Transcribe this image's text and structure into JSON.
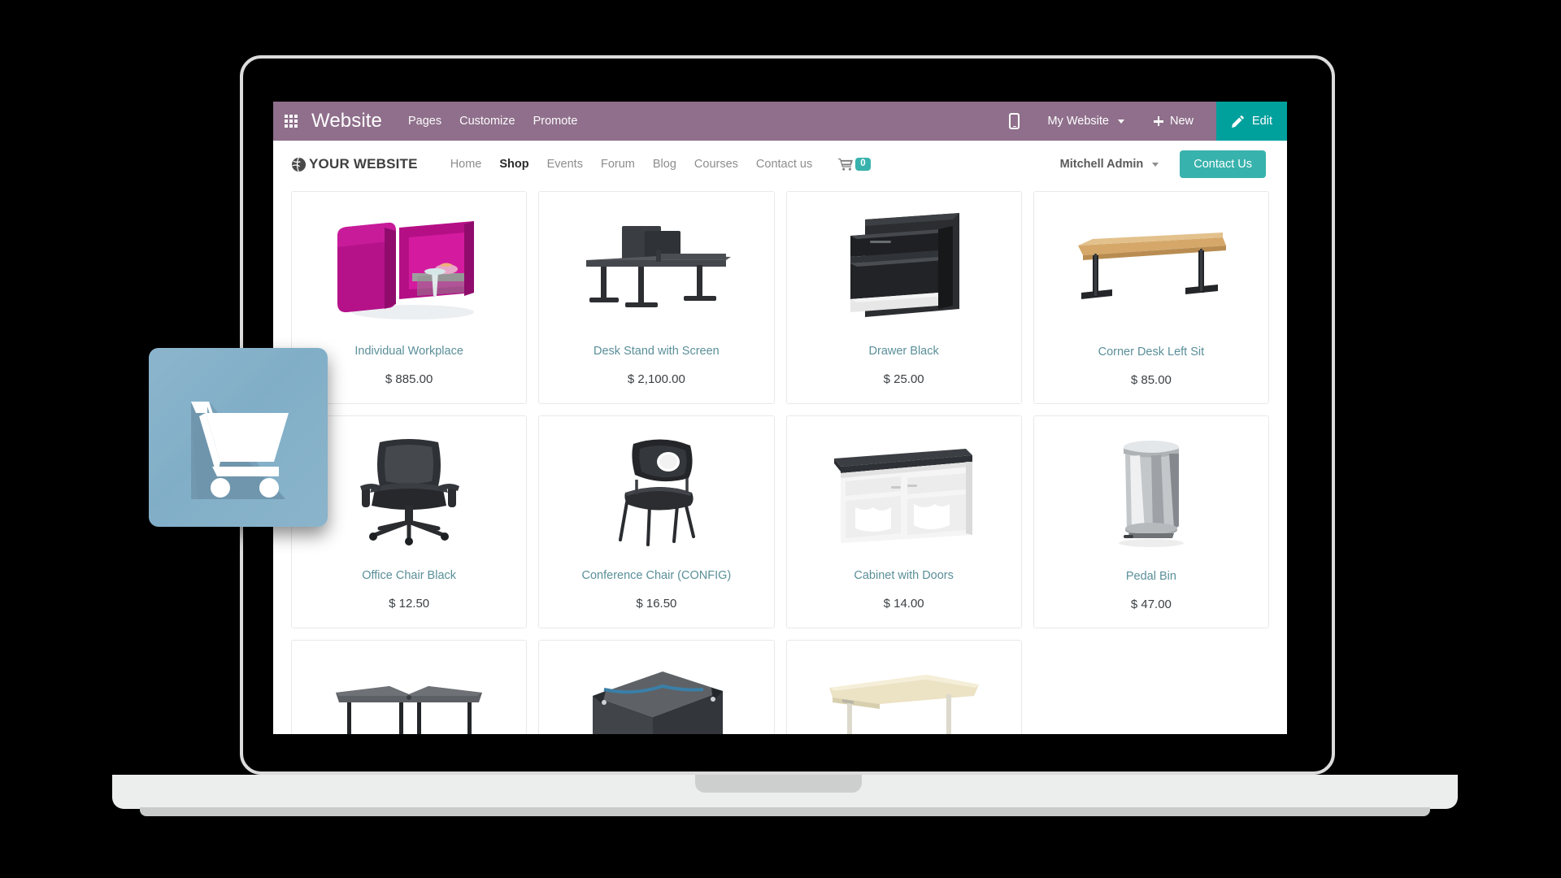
{
  "odoo_topbar": {
    "apps_icon": "apps-grid-icon",
    "app_name": "Website",
    "menus": [
      {
        "label": "Pages"
      },
      {
        "label": "Customize"
      },
      {
        "label": "Promote"
      }
    ],
    "mobile_preview_icon": "mobile-phone-icon",
    "website_selector": "My Website",
    "new_label": "New",
    "new_icon": "plus-icon",
    "edit_label": "Edit",
    "edit_icon": "pencil-icon",
    "bar_color": "#8f6f8b",
    "accent_color": "#00a09d"
  },
  "site_header": {
    "logo_icon": "globe-icon",
    "logo_text": "YOUR WEBSITE",
    "nav": [
      {
        "label": "Home",
        "active": false
      },
      {
        "label": "Shop",
        "active": true
      },
      {
        "label": "Events",
        "active": false
      },
      {
        "label": "Forum",
        "active": false
      },
      {
        "label": "Blog",
        "active": false
      },
      {
        "label": "Courses",
        "active": false
      },
      {
        "label": "Contact us",
        "active": false
      }
    ],
    "cart_icon": "shopping-cart-icon",
    "cart_count": "0",
    "user_menu": "Mitchell Admin",
    "cta_label": "Contact Us",
    "cta_color": "#38b2ac"
  },
  "shop": {
    "products": [
      {
        "name": "Individual Workplace",
        "price": "$ 885.00",
        "image": "individual-workplace"
      },
      {
        "name": "Desk Stand with Screen",
        "price": "$ 2,100.00",
        "image": "desk-stand-with-screen"
      },
      {
        "name": "Drawer Black",
        "price": "$ 25.00",
        "image": "drawer-black"
      },
      {
        "name": "Corner Desk Left Sit",
        "price": "$ 85.00",
        "image": "corner-desk-left-sit"
      },
      {
        "name": "Office Chair Black",
        "price": "$ 12.50",
        "image": "office-chair-black"
      },
      {
        "name": "Conference Chair (CONFIG)",
        "price": "$ 16.50",
        "image": "conference-chair"
      },
      {
        "name": "Cabinet with Doors",
        "price": "$ 14.00",
        "image": "cabinet-with-doors"
      },
      {
        "name": "Pedal Bin",
        "price": "$ 47.00",
        "image": "pedal-bin"
      },
      {
        "name": "",
        "price": "",
        "image": "large-meeting-table"
      },
      {
        "name": "",
        "price": "",
        "image": "storage-box"
      },
      {
        "name": "",
        "price": "",
        "image": "corner-desk-right-sit"
      },
      {
        "name": "",
        "price": "",
        "image": ""
      }
    ]
  },
  "app_icon": {
    "name": "ecommerce-app-icon",
    "glyph": "shopping-cart",
    "background_color": "#85b1ca"
  }
}
